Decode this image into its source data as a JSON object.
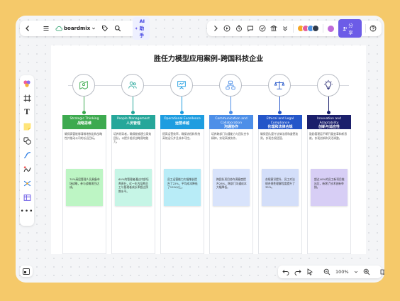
{
  "toolbar": {
    "app_name": "boardmix",
    "ai_label": "AI助手",
    "share_label": "分享"
  },
  "board": {
    "title": "胜任力模型应用案例-跨国科技企业"
  },
  "columns": [
    {
      "en": "Strategic Thinking",
      "cn": "战略思维",
      "color": "#3DAA4F",
      "sticky_color": "#BDF5C4",
      "icon": "map-pin-icon",
      "desc": "确保高管能够清晰地制定和战略性并推动公司的长远目标。",
      "sticky": "70%高层管理人员具备市场战略，参与战略项目达成。"
    },
    {
      "en": "People Management",
      "cn": "人员管理",
      "color": "#26A79A",
      "sticky_color": "#C6F5E6",
      "icon": "people-icon",
      "desc": "培养领导者，确保能够建立高效团队，以提升组织战略落地能力。",
      "sticky": "60%的管理者通过内部培养晋升，近一年内培养员工与管理者成长率超过预期水平。"
    },
    {
      "en": "Operational Excellence",
      "cn": "运营卓越",
      "color": "#1E9DE0",
      "sticky_color": "#B8ECF7",
      "icon": "presentation-icon",
      "desc": "提高运营效率，确保流程和系统高效运行并且成本可控。",
      "sticky": "员工运营能力大幅增长提升了22%，平均成本降低了15%以上。"
    },
    {
      "en": "Communication and Collaboration",
      "cn": "沟通协作",
      "color": "#4D8FE8",
      "sticky_color": "#D8E3FB",
      "icon": "network-icon",
      "desc": "培养跨部门沟通能力与团队合作精神，实现高效协作。",
      "sticky": "跨团队项目协作满意度提升28%，跨部门沟通成本大幅降低。"
    },
    {
      "en": "Ethical and Legal Compliance",
      "cn": "伦理和法律合规",
      "color": "#2456C9",
      "sticky_color": "#D3DEF9",
      "icon": "scale-icon",
      "desc": "确保团队遵守法律法规和道德准则，实现合规经营。",
      "sticky": "合规意识提升，员工对法规合规性理解程度提升了35%。"
    },
    {
      "en": "Innovation and Adaptability",
      "cn": "创新与适应性",
      "color": "#1B1F6B",
      "sticky_color": "#D7CEF5",
      "icon": "lightbulb-icon",
      "desc": "鼓励管理层不断开展变革和新思维，实现创新和灵活调整。",
      "sticky": "超过40%的员工新项目推出后，新增了技术创新举措。"
    }
  ],
  "zoom": {
    "level": "100%"
  }
}
